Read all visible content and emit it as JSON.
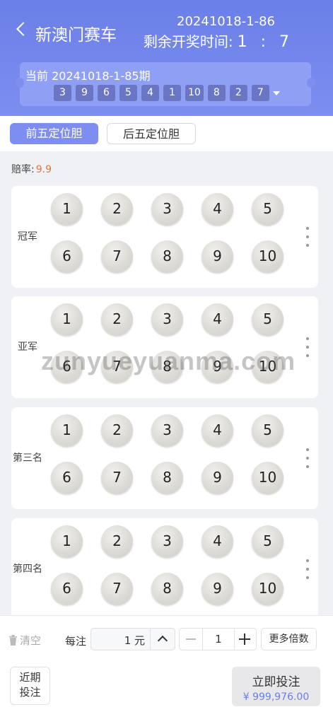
{
  "header": {
    "title": "新澳门赛车",
    "next_issue": "20241018-1-86",
    "countdown_label": "剩余开奖时间:",
    "countdown_value": "1 : 7"
  },
  "current": {
    "label": "当前 20241018-1-85期",
    "results": [
      "3",
      "9",
      "6",
      "5",
      "4",
      "1",
      "10",
      "8",
      "2",
      "7"
    ]
  },
  "tabs": {
    "front": "前五定位胆",
    "back": "后五定位胆"
  },
  "odds": {
    "label": "赔率:",
    "value": "9.9"
  },
  "sections": [
    {
      "label": "冠军",
      "numbers": [
        "1",
        "2",
        "3",
        "4",
        "5",
        "6",
        "7",
        "8",
        "9",
        "10"
      ]
    },
    {
      "label": "亚军",
      "numbers": [
        "1",
        "2",
        "3",
        "4",
        "5",
        "6",
        "7",
        "8",
        "9",
        "10"
      ]
    },
    {
      "label": "第三名",
      "numbers": [
        "1",
        "2",
        "3",
        "4",
        "5",
        "6",
        "7",
        "8",
        "9",
        "10"
      ]
    },
    {
      "label": "第四名",
      "numbers": [
        "1",
        "2",
        "3",
        "4",
        "5",
        "6",
        "7",
        "8",
        "9",
        "10"
      ]
    }
  ],
  "watermark": "zunyueyuanma.com",
  "bottom": {
    "clear": "清空",
    "per_bet": "每注",
    "unit_value": "1 元",
    "multiplier": "1",
    "more_multiplier": "更多倍数",
    "recent_line1": "近期",
    "recent_line2": "投注",
    "submit": "立即投注",
    "balance": "¥ 999,976.00"
  }
}
